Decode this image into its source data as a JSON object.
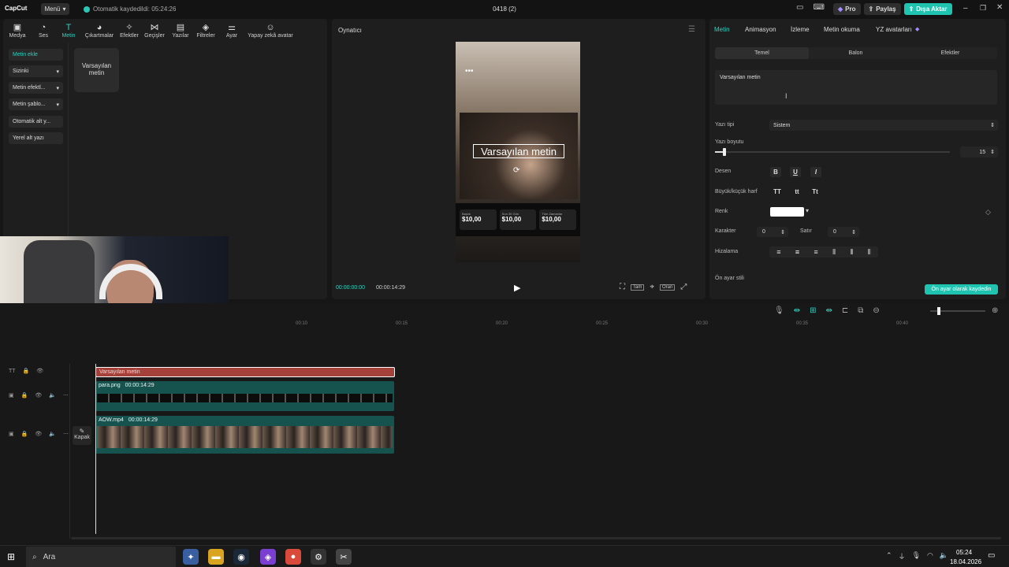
{
  "titlebar": {
    "logo": "CapCut",
    "menu": "Menü",
    "autosave": "Otomatik kaydedildi: 05:24:26",
    "project": "0418 (2)",
    "pro": "Pro",
    "share": "Paylaş",
    "export": "Dışa Aktar"
  },
  "tools": [
    "Medya",
    "Ses",
    "Metin",
    "Çıkartmalar",
    "Efektler",
    "Geçişler",
    "Yazılar",
    "Filtreler",
    "Ayar",
    "Yapay zekâ avatar"
  ],
  "sidebar": [
    "Metin ekle",
    "Sizinki",
    "Metin efektl...",
    "Metin şablo...",
    "Otomatik alt y...",
    "Yerel alt yazı"
  ],
  "card_label": "Varsayılan metin",
  "player": {
    "title": "Oynatıcı",
    "time_current": "00:00:00:00",
    "time_total": "00:00:14:29",
    "overlay_text": "Varsayılan metin",
    "price_labels": [
      "Başlık",
      "Son 30 Gün",
      "Tüm Zamanlar"
    ],
    "prices": [
      "$10,00",
      "$10,00",
      "$10,00"
    ],
    "btn_full": "Tam",
    "btn_ratio": "Oran"
  },
  "right_tabs": [
    "Metin",
    "Animasyon",
    "İzleme",
    "Metin okuma",
    "YZ avatarları"
  ],
  "segments": [
    "Temel",
    "Balon",
    "Efektler"
  ],
  "text_value": "Varsayılan metin",
  "props": {
    "font_label": "Yazı tipi",
    "font_value": "Sistem",
    "size_label": "Yazı boyutu",
    "size_value": "15",
    "pattern_label": "Desen",
    "case_label": "Büyük/küçük harf",
    "case_opts": [
      "TT",
      "tt",
      "Tt"
    ],
    "color_label": "Renk",
    "char_label": "Karakter",
    "char_value": "0",
    "line_label": "Satır",
    "line_value": "0",
    "align_label": "Hizalama",
    "preset_label": "Ön ayar stili",
    "save_preset": "Ön ayar olarak kaydedin"
  },
  "ruler": [
    "00:10",
    "00:15",
    "00:20",
    "00:25",
    "00:30",
    "00:35",
    "00:40"
  ],
  "tracks": {
    "text_clip": "Varsayılan metin",
    "png_clip": "para.png",
    "png_dur": "00:00:14:29",
    "video_clip": "AOW.mp4",
    "video_dur": "00:00:14:29",
    "cover": "Kapak"
  },
  "taskbar": {
    "search": "Ara",
    "time": "05:24",
    "date": "18.04.2026"
  }
}
